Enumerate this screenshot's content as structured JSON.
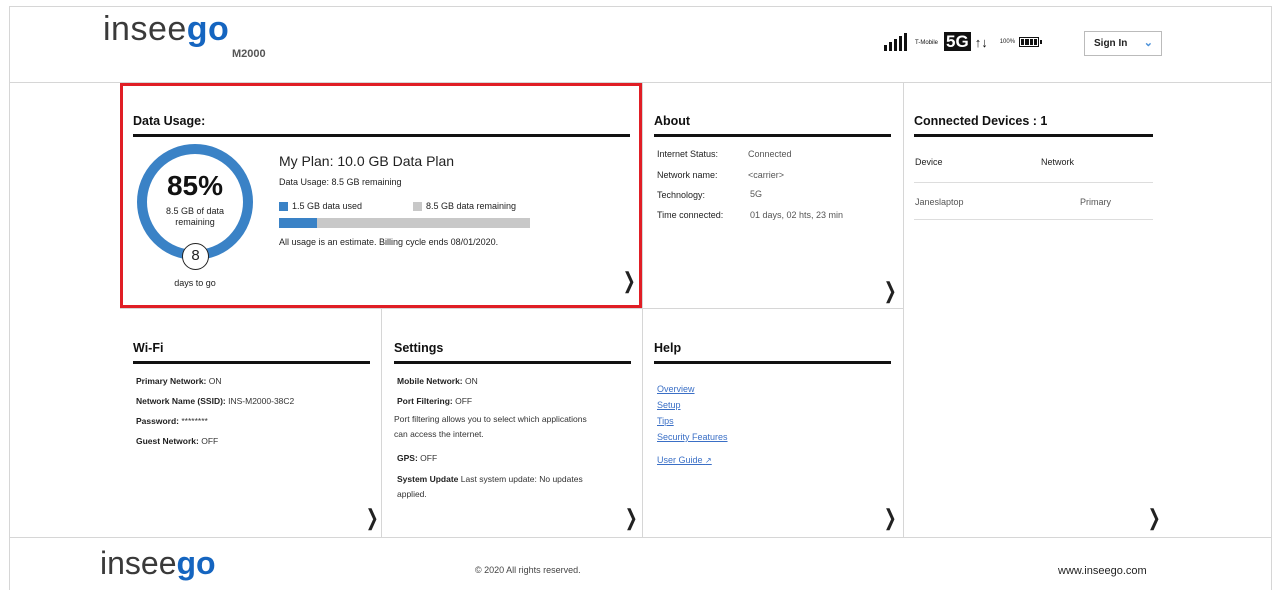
{
  "header": {
    "logo_text_a": "insee",
    "logo_text_b": "go",
    "model": "M2000",
    "carrier": "T-Mobile",
    "network_type": "5G",
    "battery": "100%",
    "signin_label": "Sign In"
  },
  "data_usage": {
    "title": "Data Usage:",
    "percent": "85%",
    "remaining_label": "8.5 GB of data remaining",
    "days": "8",
    "days_label": "days to go",
    "plan": "My Plan: 10.0 GB Data Plan",
    "usage_line": "Data Usage: 8.5 GB remaining",
    "used_legend": "1.5 GB data used",
    "remaining_legend": "8.5 GB data remaining",
    "used_fraction": 0.15,
    "estimate": "All usage is an estimate. Billing cycle ends 08/01/2020.",
    "colors": {
      "used": "#3a82c6",
      "remaining": "#c8c8c8",
      "highlight": "#e01e25"
    }
  },
  "about": {
    "title": "About",
    "rows": [
      {
        "label": "Internet Status:",
        "value": "Connected"
      },
      {
        "label": "Network name:",
        "value": "<carrier>"
      },
      {
        "label": "Technology:",
        "value": "5G"
      },
      {
        "label": "Time connected:",
        "value": "01 days, 02 hts, 23 min"
      }
    ]
  },
  "connected": {
    "title": "Connected Devices : 1",
    "col_device": "Device",
    "col_network": "Network",
    "rows": [
      {
        "device": "Janeslaptop",
        "network": "Primary"
      }
    ]
  },
  "wifi": {
    "title": "Wi-Fi",
    "rows": [
      {
        "label": "Primary Network:",
        "value": "ON"
      },
      {
        "label": "Network Name (SSID):",
        "value": "INS-M2000-38C2"
      },
      {
        "label": "Password:",
        "value": "********"
      },
      {
        "label": "Guest Network:",
        "value": "OFF"
      }
    ]
  },
  "settings": {
    "title": "Settings",
    "mobile_label": "Mobile Network:",
    "mobile_value": "ON",
    "port_label": "Port Filtering:",
    "port_value": "OFF",
    "port_desc_1": "Port filtering allows you to select which applications",
    "port_desc_2": "can access the internet.",
    "gps_label": "GPS:",
    "gps_value": "OFF",
    "update_label": "System Update",
    "update_value_1": "Last system update: No updates",
    "update_value_2": "applied."
  },
  "help": {
    "title": "Help",
    "links": [
      "Overview",
      "Setup",
      "Tips",
      "Security Features"
    ],
    "user_guide": "User Guide"
  },
  "footer": {
    "logo_text_a": "insee",
    "logo_text_b": "go",
    "copyright": "© 2020 All rights reserved.",
    "site": "www.inseego.com"
  }
}
